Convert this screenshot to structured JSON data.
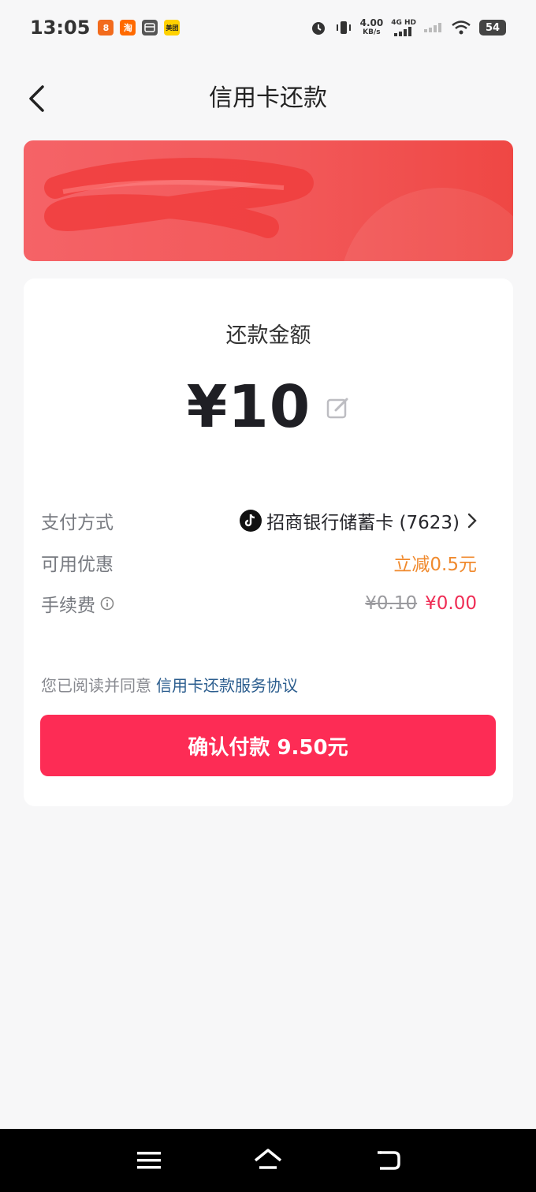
{
  "status_bar": {
    "time": "13:05",
    "net_speed_value": "4.00",
    "net_speed_unit": "KB/s",
    "signal_label": "4G HD",
    "battery": "54",
    "app_icons": [
      {
        "name": "app-icon-1",
        "color": "#f26b1d",
        "text": "8"
      },
      {
        "name": "app-icon-taobao",
        "color": "#ff6a00",
        "text": "淘"
      },
      {
        "name": "app-icon-wallet",
        "color": "#555555",
        "text": ""
      },
      {
        "name": "app-icon-meituan",
        "color": "#ffd100",
        "text": "美团"
      }
    ]
  },
  "nav": {
    "title": "信用卡还款",
    "back_icon": "chevron-left-icon"
  },
  "card_banner": {
    "gradient_start": "#f56367",
    "gradient_end": "#ef4744"
  },
  "amount": {
    "label": "还款金额",
    "value": "¥10",
    "edit_icon": "edit-icon"
  },
  "details": {
    "payment_method_label": "支付方式",
    "payment_method_value": "招商银行储蓄卡 (7623)",
    "discount_label": "可用优惠",
    "discount_value": "立减0.5元",
    "fee_label": "手续费",
    "fee_original": "¥0.10",
    "fee_current": "¥0.00"
  },
  "agreement": {
    "text": "您已阅读并同意",
    "link": "信用卡还款服务协议"
  },
  "confirm": {
    "label": "确认付款 9.50元",
    "color": "#fd2c55"
  },
  "colors": {
    "discount": "#f08a2e",
    "fee_new": "#ef2d55",
    "link": "#2b5d8e"
  }
}
